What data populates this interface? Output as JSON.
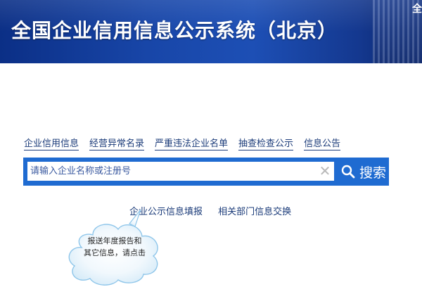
{
  "header": {
    "title": "全国企业信用信息公示系统（北京）",
    "corner_char": "全"
  },
  "nav": {
    "items": [
      {
        "label": "企业信用信息"
      },
      {
        "label": "经营异常名录"
      },
      {
        "label": "严重违法企业名单"
      },
      {
        "label": "抽查检查公示"
      },
      {
        "label": "信息公告"
      }
    ]
  },
  "search": {
    "placeholder": "请输入企业名称或注册号",
    "value": "",
    "button_label": "搜索",
    "clear_glyph": "✕"
  },
  "sub_links": {
    "fill_report": "企业公示信息填报",
    "dept_exchange": "相关部门信息交换"
  },
  "tooltip": {
    "line1": "报送年度报告和",
    "line2": "其它信息，请点击"
  },
  "colors": {
    "banner": "#1846a8",
    "search_bar": "#1f6bd1",
    "link": "#1c3c7a"
  }
}
